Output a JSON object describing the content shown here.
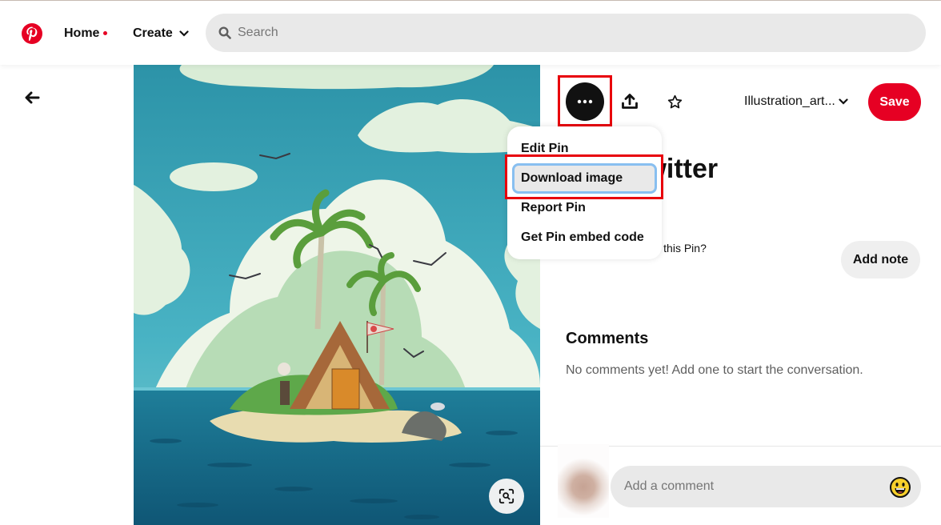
{
  "header": {
    "logo": "pinterest-logo",
    "nav": {
      "home_label": "Home",
      "home_has_notification": true,
      "create_label": "Create"
    },
    "search": {
      "placeholder": "Search",
      "value": ""
    }
  },
  "pin": {
    "image_alt": "Illustration of a small tropical island with a wooden A-frame hut, palm trees, a flag, an old man hammering, seagulls and a bird on a rock, under large clouds",
    "visual_search_icon": "lens-search-icon"
  },
  "actions": {
    "more_label": "More options",
    "share_label": "Share",
    "favorite_label": "Favorite",
    "board_select": "Illustration_art...",
    "save_label": "Save"
  },
  "menu": {
    "items": [
      {
        "label": "Edit Pin",
        "active": false
      },
      {
        "label": "Download image",
        "active": true
      },
      {
        "label": "Report Pin",
        "active": false
      },
      {
        "label": "Get Pin embed code",
        "active": false
      }
    ]
  },
  "details": {
    "title": "T on Twitter",
    "note_prompt": "to remember about this Pin?",
    "add_note_label": "Add note"
  },
  "comments": {
    "title": "Comments",
    "empty_text": "No comments yet! Add one to start the conversation.",
    "input_placeholder": "Add a comment",
    "input_value": ""
  },
  "colors": {
    "brand_red": "#e60023",
    "annotation_red": "#e8000b",
    "focus_blue": "#88bff0"
  }
}
